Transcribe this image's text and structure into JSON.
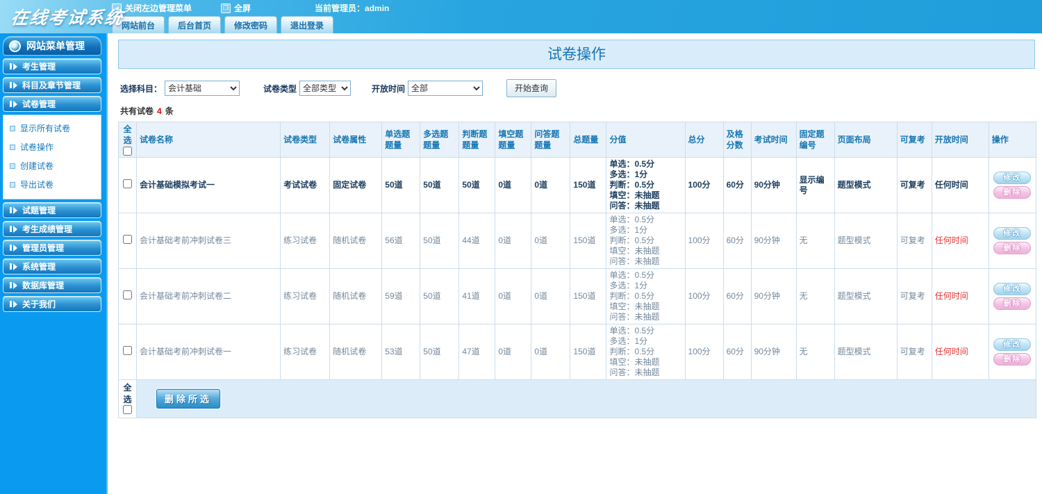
{
  "colors": {
    "accent": "#1576b4",
    "topbar_blue": "#28a5e0",
    "sidebar_blue": "#0a9af0",
    "highlight_red": "#e60000"
  },
  "topbar": {
    "logo": "在线考试系统",
    "close_menu": "关闭左边管理菜单",
    "fullscreen": "全屏",
    "admin_label": "当前管理员：admin",
    "tabs": [
      "网站前台",
      "后台首页",
      "修改密码",
      "退出登录"
    ]
  },
  "sidebar": {
    "header": "网站菜单管理",
    "items": [
      {
        "type": "group",
        "label": "考生管理"
      },
      {
        "type": "group",
        "label": "科目及章节管理"
      },
      {
        "type": "group",
        "label": "试卷管理"
      },
      {
        "type": "sub",
        "label": "显示所有试卷"
      },
      {
        "type": "sub",
        "label": "试卷操作"
      },
      {
        "type": "sub",
        "label": "创建试卷"
      },
      {
        "type": "sub",
        "label": "导出试卷"
      },
      {
        "type": "group",
        "label": "试题管理"
      },
      {
        "type": "group",
        "label": "考生成绩管理"
      },
      {
        "type": "group",
        "label": "管理员管理"
      },
      {
        "type": "group",
        "label": "系统管理"
      },
      {
        "type": "group",
        "label": "数据库管理"
      },
      {
        "type": "group",
        "label": "关于我们"
      }
    ]
  },
  "main": {
    "title": "试卷操作",
    "filters": {
      "subject_label": "选择科目：",
      "subject_value": "会计基础",
      "type_label": "试卷类型",
      "type_value": "全部类型",
      "open_label": "开放时间",
      "open_value": "全部",
      "search_button": "开始查询"
    },
    "count": {
      "prefix": "共有试卷",
      "value": "4",
      "suffix": "条"
    }
  },
  "table": {
    "headers": [
      "全选",
      "试卷名称",
      "试卷类型",
      "试卷属性",
      "单选题题量",
      "多选题题量",
      "判断题题量",
      "填空题题量",
      "问答题题量",
      "总题量",
      "分值",
      "总分",
      "及格分数",
      "考试时间",
      "固定题编号",
      "页面布局",
      "可复考",
      "开放时间",
      "操作"
    ],
    "actions": {
      "edit": "修改",
      "delete": "删除"
    },
    "footer": {
      "select_all": "全选",
      "delete_selected": "删除所选"
    },
    "rows": [
      {
        "bold": true,
        "name": "会计基础模拟考试一",
        "type": "考试试卷",
        "attr": "固定试卷",
        "single": "50道",
        "multi": "50道",
        "judge": "50道",
        "blank": "0道",
        "qa": "0道",
        "total": "150道",
        "score_lines": [
          "单选：0.5分",
          "多选：1分",
          "判断：0.5分",
          "填空：未抽题",
          "问答：未抽题"
        ],
        "total_score": "100分",
        "pass": "60分",
        "duration": "90分钟",
        "fixed": "显示编号",
        "layout": "题型模式",
        "retake": "可复考",
        "open": "任何时间"
      },
      {
        "bold": false,
        "name": "会计基础考前冲刺试卷三",
        "type": "练习试卷",
        "attr": "随机试卷",
        "single": "56道",
        "multi": "50道",
        "judge": "44道",
        "blank": "0道",
        "qa": "0道",
        "total": "150道",
        "score_lines": [
          "单选：0.5分",
          "多选：1分",
          "判断：0.5分",
          "填空：未抽题",
          "问答：未抽题"
        ],
        "total_score": "100分",
        "pass": "60分",
        "duration": "90分钟",
        "fixed": "无",
        "layout": "题型模式",
        "retake": "可复考",
        "open": "任何时间"
      },
      {
        "bold": false,
        "name": "会计基础考前冲刺试卷二",
        "type": "练习试卷",
        "attr": "随机试卷",
        "single": "59道",
        "multi": "50道",
        "judge": "41道",
        "blank": "0道",
        "qa": "0道",
        "total": "150道",
        "score_lines": [
          "单选：0.5分",
          "多选：1分",
          "判断：0.5分",
          "填空：未抽题",
          "问答：未抽题"
        ],
        "total_score": "100分",
        "pass": "60分",
        "duration": "90分钟",
        "fixed": "无",
        "layout": "题型模式",
        "retake": "可复考",
        "open": "任何时间"
      },
      {
        "bold": false,
        "name": "会计基础考前冲刺试卷一",
        "type": "练习试卷",
        "attr": "随机试卷",
        "single": "53道",
        "multi": "50道",
        "judge": "47道",
        "blank": "0道",
        "qa": "0道",
        "total": "150道",
        "score_lines": [
          "单选：0.5分",
          "多选：1分",
          "判断：0.5分",
          "填空：未抽题",
          "问答：未抽题"
        ],
        "total_score": "100分",
        "pass": "60分",
        "duration": "90分钟",
        "fixed": "无",
        "layout": "题型模式",
        "retake": "可复考",
        "open": "任何时间"
      }
    ]
  }
}
